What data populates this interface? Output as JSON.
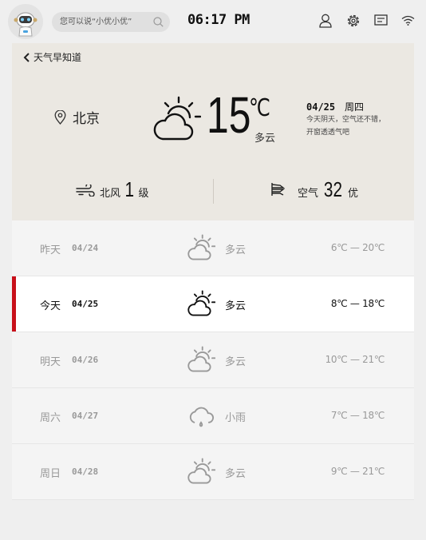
{
  "header": {
    "search_placeholder": "您可以说“小优小优”",
    "time": "06:17 PM",
    "icons": [
      "user-icon",
      "settings-icon",
      "message-icon",
      "wifi-icon"
    ]
  },
  "page": {
    "back_label": "天气早知道"
  },
  "current": {
    "city": "北京",
    "temperature": "15",
    "unit": "℃",
    "condition": "多云",
    "date": "04/25",
    "weekday": "周四",
    "tip": "今天阴天，空气还不错，开窗透透气吧",
    "wind_dir": "北风",
    "wind_level": "1",
    "wind_unit": "级",
    "air_label": "空气",
    "air_value": "32",
    "air_quality": "优"
  },
  "forecast": [
    {
      "day": "昨天",
      "date": "04/24",
      "condition": "多云",
      "range": "6℃ — 20℃",
      "icon": "cloudy-sun-icon"
    },
    {
      "day": "今天",
      "date": "04/25",
      "condition": "多云",
      "range": "8℃ — 18℃",
      "icon": "cloudy-sun-icon"
    },
    {
      "day": "明天",
      "date": "04/26",
      "condition": "多云",
      "range": "10℃ — 21℃",
      "icon": "cloudy-sun-icon"
    },
    {
      "day": "周六",
      "date": "04/27",
      "condition": "小雨",
      "range": "7℃ — 18℃",
      "icon": "light-rain-icon"
    },
    {
      "day": "周日",
      "date": "04/28",
      "condition": "多云",
      "range": "9℃ — 21℃",
      "icon": "cloudy-sun-icon"
    }
  ],
  "colors": {
    "accent": "#c8101a",
    "hero_bg": "#ebe8e2"
  }
}
